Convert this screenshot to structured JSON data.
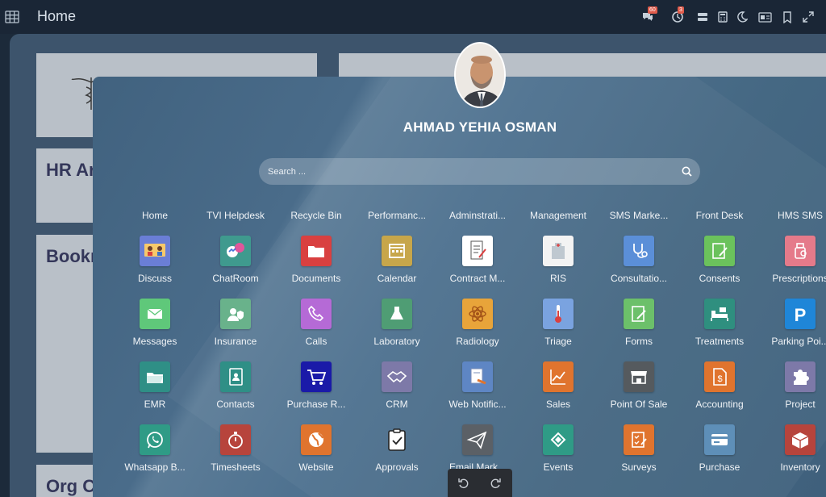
{
  "topbar": {
    "title": "Home",
    "chat_badge": "60",
    "activity_badge": "3"
  },
  "background": {
    "cards": [
      "HR Ar",
      "Bookı",
      "Org C"
    ]
  },
  "user": {
    "name": "AHMAD YEHIA OSMAN"
  },
  "search": {
    "placeholder": "Search ..."
  },
  "columns": [
    "Home",
    "TVI Helpdesk",
    "Recycle Bin",
    "Performanc...",
    "Adminstrati...",
    "Management",
    "SMS Marke...",
    "Front Desk",
    "HMS SMS"
  ],
  "apps": [
    [
      {
        "label": "Discuss",
        "icon": "discuss-icon",
        "color": "#6a7ed6"
      },
      {
        "label": "ChatRoom",
        "icon": "chatroom-icon",
        "color": "#3f9a8e"
      },
      {
        "label": "Documents",
        "icon": "folder-icon",
        "color": "#d94040"
      },
      {
        "label": "Calendar",
        "icon": "calendar-icon",
        "color": "#c7a64a"
      },
      {
        "label": "Contract M...",
        "icon": "contract-icon",
        "color": "#ffffff"
      },
      {
        "label": "RIS",
        "icon": "hospital-icon",
        "color": "#f3f3f3"
      },
      {
        "label": "Consultatio...",
        "icon": "stethoscope-icon",
        "color": "#5b8fd8"
      },
      {
        "label": "Consents",
        "icon": "consent-icon",
        "color": "#6bc25c"
      },
      {
        "label": "Prescriptions",
        "icon": "prescription-icon",
        "color": "#e57a8a"
      }
    ],
    [
      {
        "label": "Messages",
        "icon": "messages-icon",
        "color": "#5fc87a"
      },
      {
        "label": "Insurance",
        "icon": "insurance-icon",
        "color": "#69b28b"
      },
      {
        "label": "Calls",
        "icon": "phone-icon",
        "color": "#b56ad6"
      },
      {
        "label": "Laboratory",
        "icon": "flask-icon",
        "color": "#4f9d74"
      },
      {
        "label": "Radiology",
        "icon": "atom-icon",
        "color": "#e8a43a"
      },
      {
        "label": "Triage",
        "icon": "thermometer-icon",
        "color": "#7aa3e0"
      },
      {
        "label": "Forms",
        "icon": "form-icon",
        "color": "#6cc06a"
      },
      {
        "label": "Treatments",
        "icon": "bed-icon",
        "color": "#2f8f7f"
      },
      {
        "label": "Parking Poi...",
        "icon": "parking-icon",
        "color": "#1f86d8"
      }
    ],
    [
      {
        "label": "EMR",
        "icon": "emr-folder-icon",
        "color": "#2f8f86"
      },
      {
        "label": "Contacts",
        "icon": "contacts-icon",
        "color": "#2f8f86"
      },
      {
        "label": "Purchase R...",
        "icon": "cart-icon",
        "color": "#1a1aa8"
      },
      {
        "label": "CRM",
        "icon": "handshake-icon",
        "color": "#7d79a8"
      },
      {
        "label": "Web Notific...",
        "icon": "notification-icon",
        "color": "#5e86c4"
      },
      {
        "label": "Sales",
        "icon": "chart-icon",
        "color": "#e0742e"
      },
      {
        "label": "Point Of Sale",
        "icon": "store-icon",
        "color": "#555a5e"
      },
      {
        "label": "Accounting",
        "icon": "accounting-icon",
        "color": "#e0742e"
      },
      {
        "label": "Project",
        "icon": "puzzle-icon",
        "color": "#7d79a8"
      }
    ],
    [
      {
        "label": "Whatsapp B...",
        "icon": "whatsapp-icon",
        "color": "#2f9b86"
      },
      {
        "label": "Timesheets",
        "icon": "stopwatch-icon",
        "color": "#b7443c"
      },
      {
        "label": "Website",
        "icon": "globe-icon",
        "color": "#e0742e"
      },
      {
        "label": "Approvals",
        "icon": "clipboard-check-icon",
        "color": "#ffffff"
      },
      {
        "label": "Email Mark...",
        "icon": "paper-plane-icon",
        "color": "#5b6066"
      },
      {
        "label": "Events",
        "icon": "ticket-icon",
        "color": "#2f9b86"
      },
      {
        "label": "Surveys",
        "icon": "survey-icon",
        "color": "#e0742e"
      },
      {
        "label": "Purchase",
        "icon": "card-icon",
        "color": "#5e8fb8"
      },
      {
        "label": "Inventory",
        "icon": "box-icon",
        "color": "#b7443c"
      }
    ]
  ]
}
